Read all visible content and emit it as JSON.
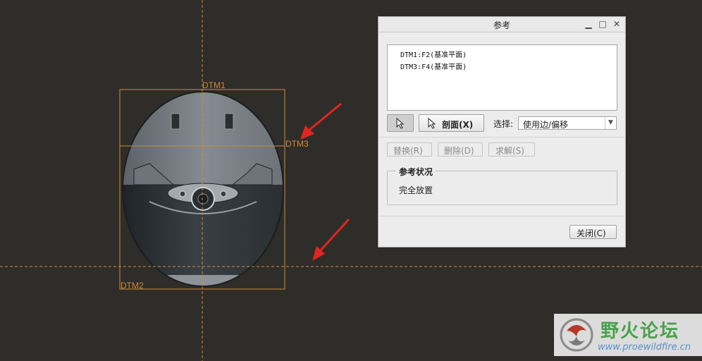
{
  "viewport": {
    "datum_labels": {
      "dtm1": "DTM1",
      "dtm2": "DTM2",
      "dtm3": "DTM3"
    },
    "colors": {
      "background": "#2f2d29",
      "datum": "#d08a38",
      "annotation": "#e0271f"
    }
  },
  "dialog": {
    "title": "参考",
    "window_controls": [
      "minimize-icon",
      "maximize-icon",
      "close-icon"
    ],
    "references": [
      "DTM1:F2(基准平面)",
      "DTM3:F4(基准平面)"
    ],
    "pointer_button_icon": "cursor-icon",
    "section_button": "剖面(X)",
    "select_label": "选择:",
    "select_value": "使用边/偏移",
    "replace_button": "替换(R)",
    "delete_button": "删除(D)",
    "solve_button": "求解(S)",
    "status_group_title": "参考状况",
    "status_text": "完全放置",
    "close_button": "关闭(C)"
  },
  "watermark": {
    "brand": "野火论坛",
    "url": "www.proewildfire.cn"
  }
}
